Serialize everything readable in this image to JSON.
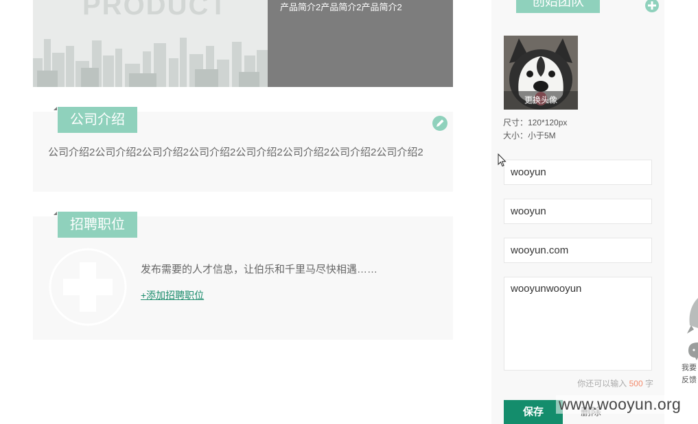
{
  "product": {
    "banner_word": "PRODUCT",
    "description": "产品简介2产品简介2产品简介2"
  },
  "company_intro": {
    "title": "公司介绍",
    "text": "公司介绍2公司介绍2公司介绍2公司介绍2公司介绍2公司介绍2公司介绍2公司介绍2"
  },
  "jobs": {
    "title": "招聘职位",
    "description": "发布需要的人才信息，让伯乐和千里马尽快相遇……",
    "add_link": "+添加招聘职位"
  },
  "team": {
    "title": "创始团队",
    "avatar_change_label": "更换头像",
    "avatar_size_hint": "尺寸：120*120px",
    "avatar_file_hint": "大小：小于5M",
    "name_value": "wooyun",
    "position_value": "wooyun",
    "link_value": "wooyun.com",
    "bio_value": "wooyunwooyun",
    "remaining_prefix": "你还可以输入",
    "remaining_count": "500",
    "remaining_suffix": "字",
    "save_label": "保存",
    "delete_label": "删除"
  },
  "feedback": {
    "label": "我要反馈"
  },
  "watermark": "www.wooyun.org",
  "colors": {
    "accent_green": "#8fd1bc",
    "button_green": "#148d6c",
    "count_orange": "#f38a6b"
  }
}
